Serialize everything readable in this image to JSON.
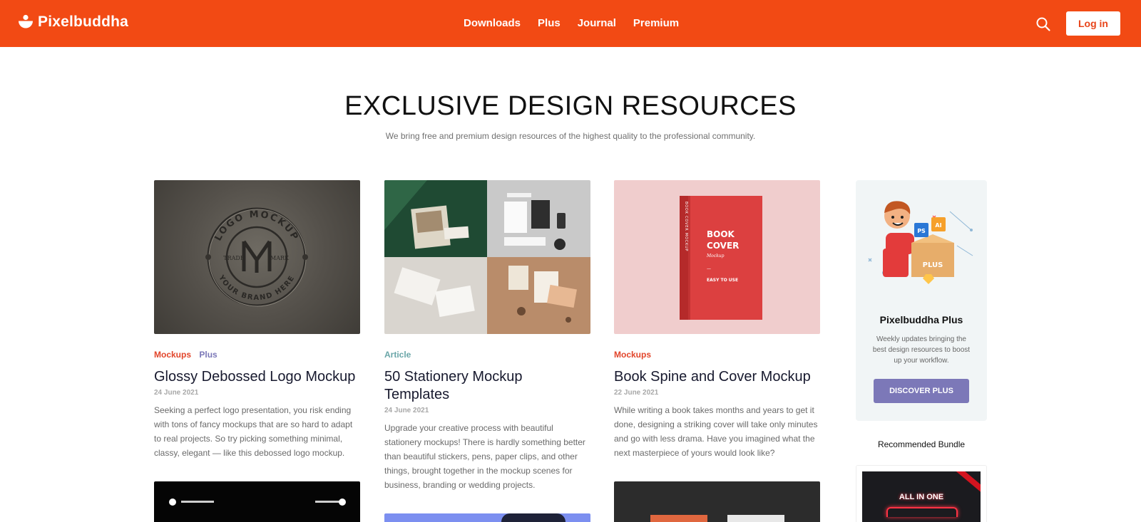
{
  "header": {
    "brand": "Pixelbuddha",
    "nav": [
      "Downloads",
      "Plus",
      "Journal",
      "Premium"
    ],
    "login_label": "Log in",
    "icons": {
      "logo": "logo-mark",
      "search": "search-icon"
    },
    "accent_color": "#f24a14"
  },
  "hero": {
    "title": "EXCLUSIVE DESIGN RESOURCES",
    "subtitle": "We bring free and premium design resources of the highest quality to the professional community."
  },
  "cards": [
    {
      "tags": [
        "Mockups",
        "Plus"
      ],
      "title": "Glossy Debossed Logo Mockup",
      "date": "24 June 2021",
      "description": "Seeking a perfect logo presentation, you risk ending with tons of fancy mockups that are so hard to adapt to real projects. So try picking something minimal, classy, elegant — like this debossed logo mockup.",
      "image_text": {
        "top": "LOGO MOCKUP",
        "bottom": "YOUR BRAND HERE",
        "left": "TRADE",
        "right": "MARK"
      }
    },
    {
      "tags": [
        "Article"
      ],
      "title": "50 Stationery Mockup Templates",
      "date": "24 June 2021",
      "description": "Upgrade your creative process with beautiful stationery mockups! There is hardly something better than beautiful stickers, pens, paper clips, and other things, brought together in the mockup scenes for business, branding or wedding projects."
    },
    {
      "tags": [
        "Mockups"
      ],
      "title": "Book Spine and Cover Mockup",
      "date": "22 June 2021",
      "description": "While writing a book takes months and years to get it done, designing a striking cover will take only minutes and go with less drama. Have you imagined what the next masterpiece of yours would look like?",
      "image_text": {
        "cover_line1": "BOOK",
        "cover_line2": "COVER",
        "cover_script": "Mockup",
        "cover_dash": "—",
        "cover_tag": "EASY TO USE",
        "spine": "BOOK COVER MOCKUP"
      }
    }
  ],
  "sidebar": {
    "promo_title": "Pixelbuddha Plus",
    "promo_desc": "Weekly updates bringing the best design resources to boost up your workflow.",
    "promo_button": "DISCOVER PLUS",
    "illustration_badges": [
      "PS",
      "AI",
      "PLUS"
    ],
    "recommended_title": "Recommended Bundle",
    "bundle_text": "ALL IN ONE"
  }
}
